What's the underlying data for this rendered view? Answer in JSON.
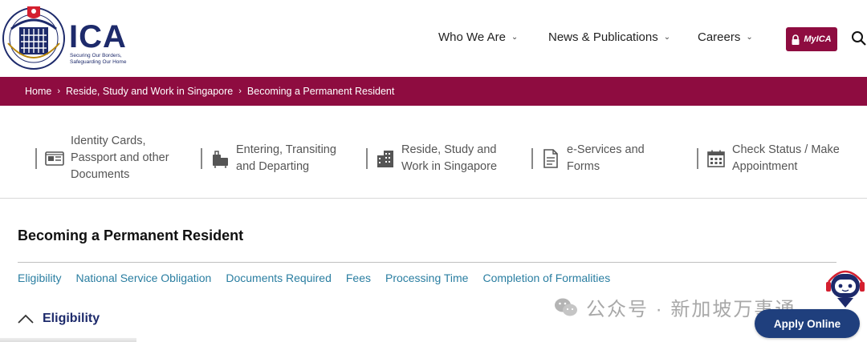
{
  "header": {
    "logo_text": "ICA",
    "tagline": "Securing Our Borders, Safeguarding Our Home",
    "nav": [
      {
        "label": "Who We Are"
      },
      {
        "label": "News & Publications"
      },
      {
        "label": "Careers"
      }
    ],
    "myica_label": "MyICA"
  },
  "breadcrumb": [
    "Home",
    "Reside, Study and Work in Singapore",
    "Becoming a Permanent Resident"
  ],
  "categories": [
    {
      "label": "Identity Cards, Passport and other Documents",
      "icon": "id-card-icon"
    },
    {
      "label": "Entering, Transiting and Departing",
      "icon": "luggage-icon"
    },
    {
      "label": "Reside, Study and Work in Singapore",
      "icon": "building-icon"
    },
    {
      "label": "e-Services and Forms",
      "icon": "document-icon"
    },
    {
      "label": "Check Status / Make Appointment",
      "icon": "calendar-icon"
    }
  ],
  "main": {
    "title": "Becoming a Permanent Resident",
    "tabs": [
      "Eligibility",
      "National Service Obligation",
      "Documents Required",
      "Fees",
      "Processing Time",
      "Completion of Formalities"
    ],
    "accordion_title": "Eligibility"
  },
  "watermark": "公众号 · 新加坡万事通",
  "apply_label": "Apply Online",
  "colors": {
    "brand_maroon": "#8e0c40",
    "navy": "#1d2a6b",
    "link": "#2a7ea1",
    "apply_blue": "#1f3f7d"
  }
}
